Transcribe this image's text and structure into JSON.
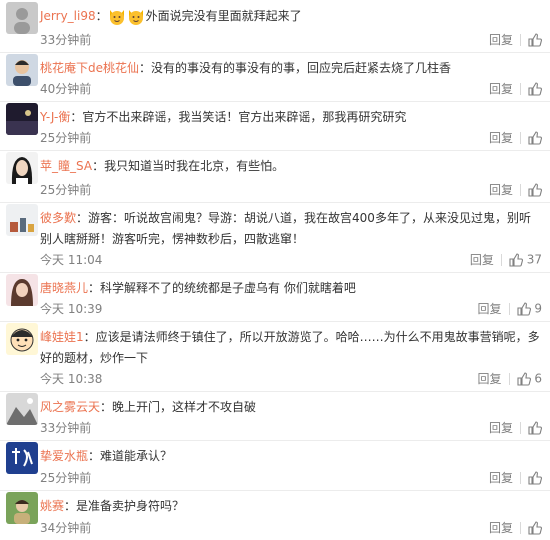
{
  "comments": [
    {
      "user": "Jerry_li98",
      "sep": "：",
      "text": "外面说完没有里面就拜起来了",
      "time": "33分钟前",
      "reply": "回复",
      "likes": "",
      "emoji": [
        "cat-face",
        "cat-face"
      ]
    },
    {
      "user": "桃花庵下de桃花仙",
      "sep": "：",
      "text": "没有的事没有的事没有的事，回应完后赶紧去烧了几柱香",
      "time": "40分钟前",
      "reply": "回复",
      "likes": ""
    },
    {
      "user": "Y-J-衡",
      "sep": "：",
      "text": "官方不出来辟谣，我当笑话！官方出来辟谣，那我再研究研究",
      "time": "25分钟前",
      "reply": "回复",
      "likes": ""
    },
    {
      "user": "苹_瞳_SA",
      "sep": "：",
      "text": "我只知道当时我在北京，有些怕。",
      "time": "25分钟前",
      "reply": "回复",
      "likes": ""
    },
    {
      "user": "彼多歎",
      "sep": "：",
      "text": "游客：听说故宫闹鬼？导游：胡说八道，我在故宫400多年了，从来没见过鬼，别听别人瞎掰掰！游客听完，愣神数秒后，四散逃窜！",
      "time": "今天 11:04",
      "reply": "回复",
      "likes": "37"
    },
    {
      "user": "唐晓燕儿",
      "sep": "：",
      "text": "科学解释不了的统统都是子虚乌有 你们就瞎着吧",
      "time": "今天 10:39",
      "reply": "回复",
      "likes": "9"
    },
    {
      "user": "峰娃娃1",
      "sep": "：",
      "text": "应该是请法师终于镇住了，所以开放游览了。哈哈……为什么不用鬼故事营销呢，多好的题材，炒作一下",
      "time": "今天 10:38",
      "reply": "回复",
      "likes": "6"
    },
    {
      "user": "风之雾云天",
      "sep": "：",
      "text": "晚上开门，这样才不攻自破",
      "time": "33分钟前",
      "reply": "回复",
      "likes": ""
    },
    {
      "user": "挚爱水瓶",
      "sep": "：",
      "text": "难道能承认？",
      "time": "25分钟前",
      "reply": "回复",
      "likes": ""
    },
    {
      "user": "姚赛",
      "sep": "：",
      "text": "是准备卖护身符吗？",
      "time": "34分钟前",
      "reply": "回复",
      "likes": ""
    }
  ],
  "colors": {
    "username": "#eb7350",
    "meta": "#808080",
    "text": "#333333"
  }
}
